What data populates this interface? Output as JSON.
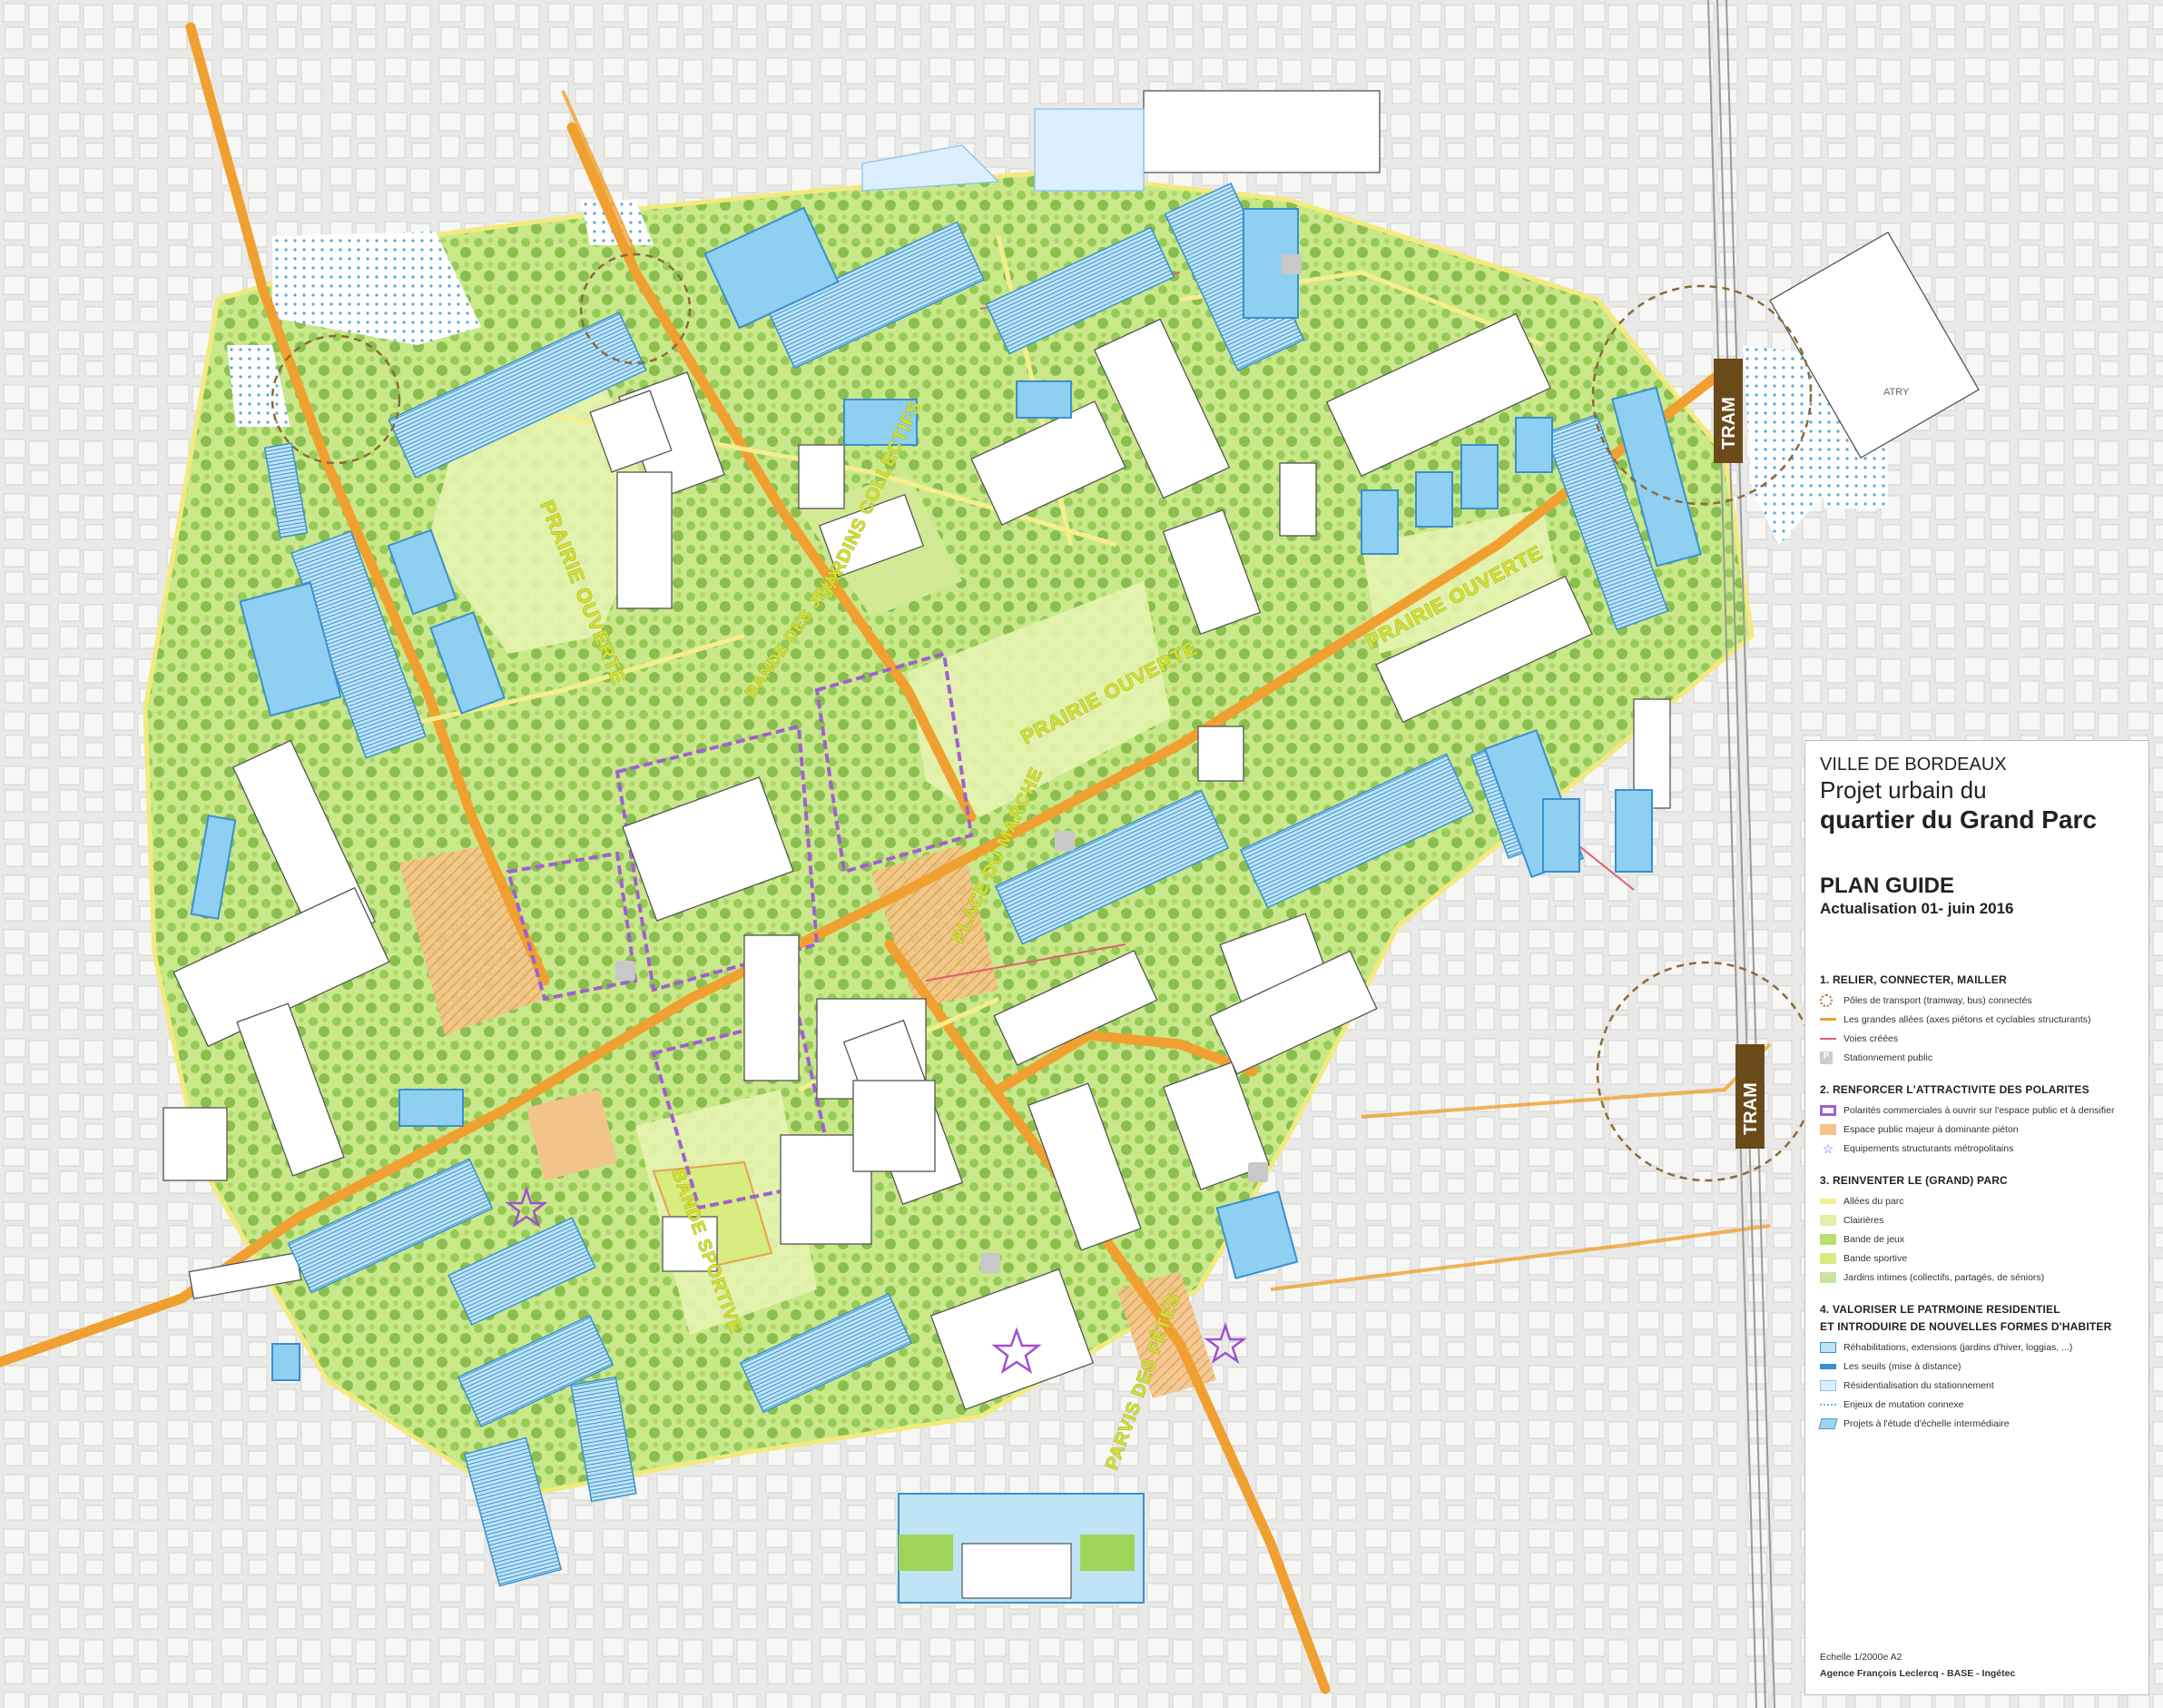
{
  "map": {
    "labels": {
      "prairie_ouverte_1": "PRAIRIE OUVERTE",
      "prairie_ouverte_2": "PRAIRIE OUVERTE",
      "prairie_ouverte_3": "PRAIRIE OUVERTE",
      "jardins_collectifs": "JARDINS COLLECTIFS",
      "bande_des_jeux": "BANDE DES JEUX",
      "place_du_marche": "PLACE DU MARCHE",
      "bande_sportive": "BANDE SPORTIVE",
      "parvis_des_fetes": "PARVIS DES FÊTES",
      "tram_1": "TRAM",
      "tram_2": "TRAM",
      "atry": "ATRY"
    },
    "colors": {
      "background": "#eeeeec",
      "grand_allee": "#f0a030",
      "park_green": "#b9e070",
      "clairiere": "#e6f3b0",
      "building_blue": "#8fd0f2",
      "violet": "#a060d0",
      "tram_circle": "#8a6a3a"
    }
  },
  "legend": {
    "city": "VILLE DE BORDEAUX",
    "title_line1": "Projet urbain du",
    "title_line2": "quartier du Grand Parc",
    "plan": "PLAN GUIDE",
    "update": "Actualisation 01- juin 2016",
    "sections": [
      {
        "title": "1. RELIER, CONNECTER, MAILLER",
        "items": [
          {
            "text": "Pôles de transport (tramway, bus) connectés",
            "symbol": "pole"
          },
          {
            "text": "Les grandes allées (axes piétons et cyclables structurants)",
            "symbol": "orange-line"
          },
          {
            "text": "Voies créées",
            "symbol": "red-line"
          },
          {
            "text": "Stationnement public",
            "symbol": "p"
          }
        ]
      },
      {
        "title": "2. RENFORCER L'ATTRACTIVITE DES POLARITES",
        "items": [
          {
            "text": "Polarités commerciales à ouvrir sur l'espace public et à densifier",
            "symbol": "violet"
          },
          {
            "text": "Espace public majeur à dominante piéton",
            "symbol": "orangefill"
          },
          {
            "text": "Equipements structurants métropolitains",
            "symbol": "star"
          }
        ]
      },
      {
        "title": "3. REINVENTER LE (GRAND) PARC",
        "items": [
          {
            "text": "Allées du parc",
            "symbol": "allee"
          },
          {
            "text": "Clairières",
            "symbol": "clairiere"
          },
          {
            "text": "Bande de jeux",
            "symbol": "bande"
          },
          {
            "text": "Bande sportive",
            "symbol": "sport"
          },
          {
            "text": "Jardins intimes (collectifs, partagés, de séniors)",
            "symbol": "jardin"
          }
        ]
      },
      {
        "title": "4. VALORISER LE PATRMOINE RESIDENTIEL",
        "title2": "ET INTRODUIRE DE NOUVELLES FORMES D'HABITER",
        "items": [
          {
            "text": "Réhabilitations, extensions (jardins d'hiver, loggias, ...)",
            "symbol": "rehab"
          },
          {
            "text": "Les seuils (mise à distance)",
            "symbol": "seuil"
          },
          {
            "text": "Résidentialisation du stationnement",
            "symbol": "resid"
          },
          {
            "text": "Enjeux de mutation connexe",
            "symbol": "mutation"
          },
          {
            "text": "Projets à l'étude d'échelle intermédiaire",
            "symbol": "projet"
          }
        ]
      }
    ],
    "scale": "Echelle 1/2000e  A2",
    "credits": "Agence François Leclercq - BASE - Ingétec"
  }
}
